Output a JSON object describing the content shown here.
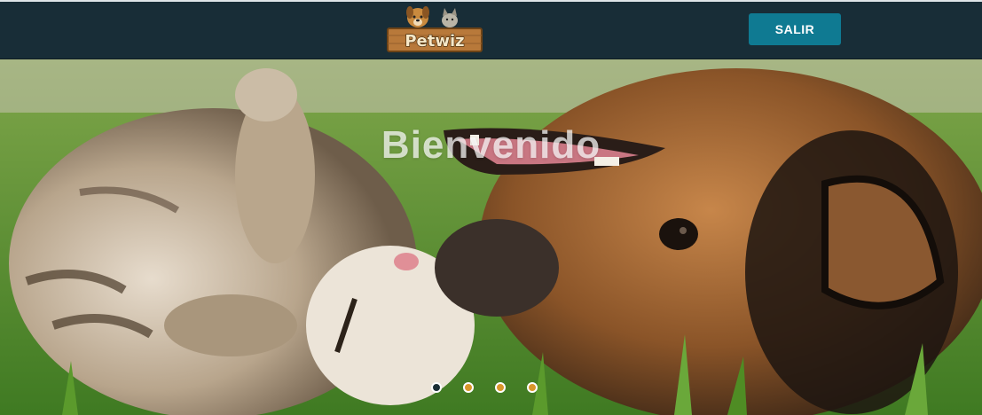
{
  "header": {
    "logo_text": "Petwiz",
    "logo_icon": "dog-and-cat-logo",
    "exit_label": "SALIR",
    "exit_color": "#0f7a92",
    "bar_color": "#182d37"
  },
  "hero": {
    "title": "Bienvenido",
    "image_icon": "cat-and-dog-playing-photo",
    "slides": [
      {
        "active": true,
        "color": "#1c2f36"
      },
      {
        "active": false,
        "color": "#d9962a"
      },
      {
        "active": false,
        "color": "#d9962a"
      },
      {
        "active": false,
        "color": "#d9962a"
      }
    ]
  }
}
